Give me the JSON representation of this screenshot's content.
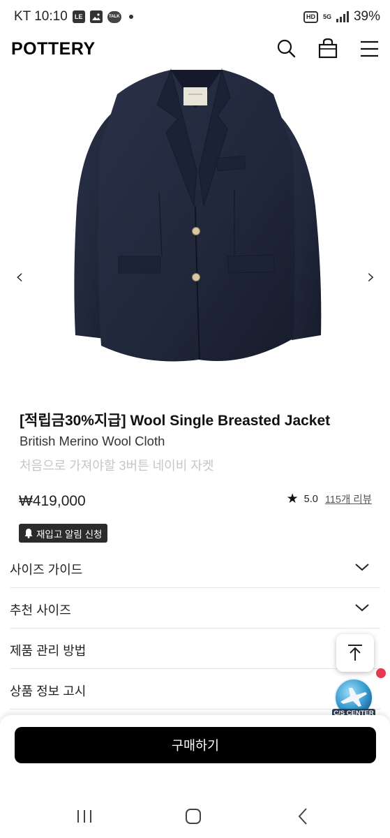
{
  "status_bar": {
    "carrier_time": "KT 10:10",
    "lte_badge": "LE",
    "talk_badge": "TALK",
    "hd_badge": "HD",
    "net_type": "5G",
    "battery": "39%"
  },
  "header": {
    "logo": "POTTERY"
  },
  "product": {
    "title": "[적립금30%지급] Wool Single Breasted Jacket",
    "subtitle": "British Merino Wool Cloth",
    "description": "처음으로 가져야할 3버튼 네이비 자켓",
    "price": "₩419,000",
    "rating": "5.0",
    "review_link": "115개 리뷰",
    "restock_label": "재입고 알림 신청",
    "image_icon": "jacket-illustration",
    "prev_arrow": "‹",
    "next_arrow": "›"
  },
  "accordion": {
    "items": [
      {
        "label": "사이즈 가이드"
      },
      {
        "label": "추천 사이즈"
      },
      {
        "label": "제품 관리 방법"
      },
      {
        "label": "상품 정보 고시"
      }
    ]
  },
  "floating": {
    "cs_label": "C/S CENTER"
  },
  "bottom": {
    "buy_label": "구매하기"
  },
  "colors": {
    "jacket": "#232a3f",
    "buy_button": "#000000",
    "notification_dot": "#e8384f"
  }
}
